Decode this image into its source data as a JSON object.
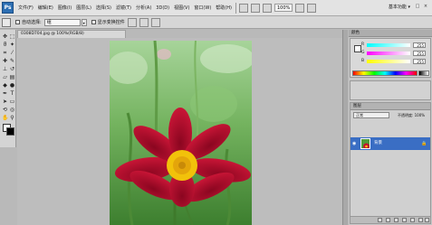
{
  "app": {
    "logo": "Ps"
  },
  "menu": {
    "items": [
      "文件(F)",
      "编辑(E)",
      "图像(I)",
      "图层(L)",
      "选择(S)",
      "滤镜(T)",
      "分析(A)",
      "3D(D)",
      "视图(V)",
      "窗口(W)",
      "帮助(H)"
    ],
    "zoom": "100%",
    "workspace": "基本功能 ▾"
  },
  "options": {
    "auto_select_label": "自动选择:",
    "auto_select_value": "组",
    "show_transform_label": "显示变换控件"
  },
  "document": {
    "tab_title": "0308D704.jpg @ 100%(RGB/8)"
  },
  "color_panel": {
    "tab_label": "颜色",
    "channels": [
      {
        "label": "R",
        "value": "255"
      },
      {
        "label": "G",
        "value": "255"
      },
      {
        "label": "B",
        "value": "255"
      }
    ]
  },
  "layers_panel": {
    "tab_label": "图层",
    "blend_mode": "正常",
    "opacity_label": "不透明度: 100%",
    "layers": [
      {
        "name": "背景"
      }
    ]
  },
  "colors": {
    "accent": "#3a6ec4",
    "flower": "#c3102d",
    "center": "#f2c10a",
    "leaf": "#4f9a3a"
  }
}
